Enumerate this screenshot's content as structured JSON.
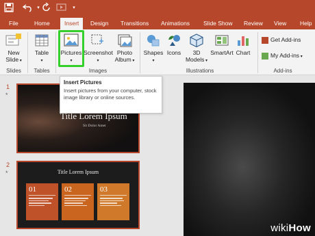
{
  "tabs": [
    "File",
    "Home",
    "Insert",
    "Design",
    "Transitions",
    "Animations",
    "Slide Show",
    "Review",
    "View",
    "Help"
  ],
  "active_tab": "Insert",
  "ribbon": {
    "new_slide": [
      "New",
      "Slide"
    ],
    "table": "Table",
    "pictures": "Pictures",
    "screenshot": "Screenshot",
    "photo_album": [
      "Photo",
      "Album"
    ],
    "shapes": "Shapes",
    "icons": "Icons",
    "models_3d": [
      "3D",
      "Models"
    ],
    "smartart": "SmartArt",
    "chart": "Chart",
    "get_addins": "Get Add-ins",
    "my_addins": "My Add-ins",
    "groups": {
      "slides": "Slides",
      "tables": "Tables",
      "images": "Images",
      "illustrations": "Illustrations",
      "addins": "Add-ins"
    }
  },
  "tooltip": {
    "title": "Insert Pictures",
    "body": "Insert pictures from your computer, stock image library or online sources."
  },
  "slides": [
    {
      "number": "1",
      "star": "*",
      "title": "Title Lorem Ipsum",
      "subtitle": "Sit Dolor Amet"
    },
    {
      "number": "2",
      "star": "*",
      "title": "Title Lorem Ipsum",
      "cards": [
        "01",
        "02",
        "03"
      ]
    }
  ],
  "colors": {
    "accent": "#b7472a",
    "highlight": "#35d12a",
    "card1": "#c0522a",
    "card2": "#c9651f",
    "card3": "#d0792a"
  },
  "watermark": {
    "wiki": "wiki",
    "how": "How"
  }
}
